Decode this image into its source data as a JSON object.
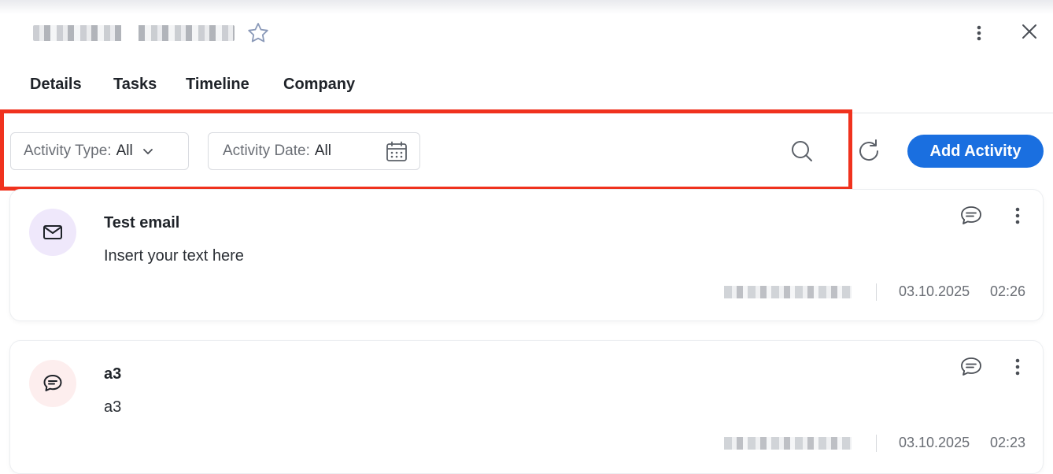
{
  "header": {
    "record_name_redacted": true,
    "icons": {
      "favorite": "star-icon",
      "more": "more-vertical-icon",
      "close": "close-icon"
    }
  },
  "tabs": [
    {
      "label": "Details"
    },
    {
      "label": "Tasks"
    },
    {
      "label": "Timeline"
    },
    {
      "label": "Company"
    }
  ],
  "filters": {
    "activity_type": {
      "label": "Activity Type:",
      "value": "All",
      "icon": "chevron-down-icon"
    },
    "activity_date": {
      "label": "Activity Date:",
      "value": "All",
      "icon": "calendar-icon"
    },
    "search_icon": "search-icon",
    "refresh_icon": "refresh-icon",
    "add_activity_label": "Add Activity"
  },
  "activities": [
    {
      "title": "Test email",
      "body": "Insert your text here",
      "icon": "mail-icon",
      "date": "03.10.2025",
      "time": "02:26"
    },
    {
      "title": "a3",
      "body": "a3",
      "icon": "comment-icon",
      "date": "03.10.2025",
      "time": "02:23"
    }
  ],
  "colors": {
    "accent": "#1a6fe0",
    "highlight": "#f0321e",
    "email_avatar_bg": "#efe8fb",
    "comment_avatar_bg": "#fdeeee"
  }
}
